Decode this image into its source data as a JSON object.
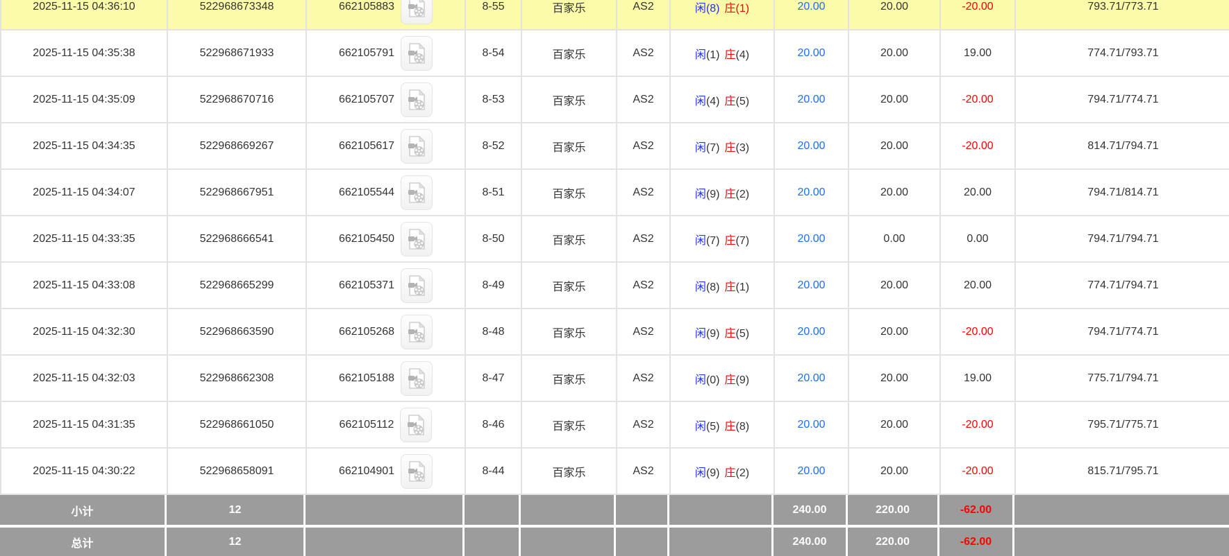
{
  "colors": {
    "highlight_bg": "#fbfba9",
    "summary_bg": "#9c9c9c",
    "amount_blue": "#1a6ff2",
    "player_blue": "#2033f0",
    "banker_red": "#ff0000",
    "negative_red": "#ff0000",
    "text": "#333333",
    "border": "#e2e2e2"
  },
  "table": {
    "result_labels": {
      "player": "闲",
      "banker": "庄"
    },
    "video_icon_name": "video-replay-icon",
    "rows": [
      {
        "time": "2025-11-15 04:36:10",
        "bet_id": "522968673348",
        "round_id": "662105883",
        "round_no": "8-55",
        "game": "百家乐",
        "table": "AS2",
        "player_score": "8",
        "banker_score": "1",
        "valid_bet": "20.00",
        "bet_amount": "20.00",
        "win_loss": "-20.00",
        "balance": "793.71/773.71",
        "highlighted": true
      },
      {
        "time": "2025-11-15 04:35:38",
        "bet_id": "522968671933",
        "round_id": "662105791",
        "round_no": "8-54",
        "game": "百家乐",
        "table": "AS2",
        "player_score": "1",
        "banker_score": "4",
        "valid_bet": "20.00",
        "bet_amount": "20.00",
        "win_loss": "19.00",
        "balance": "774.71/793.71",
        "highlighted": false
      },
      {
        "time": "2025-11-15 04:35:09",
        "bet_id": "522968670716",
        "round_id": "662105707",
        "round_no": "8-53",
        "game": "百家乐",
        "table": "AS2",
        "player_score": "4",
        "banker_score": "5",
        "valid_bet": "20.00",
        "bet_amount": "20.00",
        "win_loss": "-20.00",
        "balance": "794.71/774.71",
        "highlighted": false
      },
      {
        "time": "2025-11-15 04:34:35",
        "bet_id": "522968669267",
        "round_id": "662105617",
        "round_no": "8-52",
        "game": "百家乐",
        "table": "AS2",
        "player_score": "7",
        "banker_score": "3",
        "valid_bet": "20.00",
        "bet_amount": "20.00",
        "win_loss": "-20.00",
        "balance": "814.71/794.71",
        "highlighted": false
      },
      {
        "time": "2025-11-15 04:34:07",
        "bet_id": "522968667951",
        "round_id": "662105544",
        "round_no": "8-51",
        "game": "百家乐",
        "table": "AS2",
        "player_score": "9",
        "banker_score": "2",
        "valid_bet": "20.00",
        "bet_amount": "20.00",
        "win_loss": "20.00",
        "balance": "794.71/814.71",
        "highlighted": false
      },
      {
        "time": "2025-11-15 04:33:35",
        "bet_id": "522968666541",
        "round_id": "662105450",
        "round_no": "8-50",
        "game": "百家乐",
        "table": "AS2",
        "player_score": "7",
        "banker_score": "7",
        "valid_bet": "20.00",
        "bet_amount": "0.00",
        "win_loss": "0.00",
        "balance": "794.71/794.71",
        "highlighted": false
      },
      {
        "time": "2025-11-15 04:33:08",
        "bet_id": "522968665299",
        "round_id": "662105371",
        "round_no": "8-49",
        "game": "百家乐",
        "table": "AS2",
        "player_score": "8",
        "banker_score": "1",
        "valid_bet": "20.00",
        "bet_amount": "20.00",
        "win_loss": "20.00",
        "balance": "774.71/794.71",
        "highlighted": false
      },
      {
        "time": "2025-11-15 04:32:30",
        "bet_id": "522968663590",
        "round_id": "662105268",
        "round_no": "8-48",
        "game": "百家乐",
        "table": "AS2",
        "player_score": "9",
        "banker_score": "5",
        "valid_bet": "20.00",
        "bet_amount": "20.00",
        "win_loss": "-20.00",
        "balance": "794.71/774.71",
        "highlighted": false
      },
      {
        "time": "2025-11-15 04:32:03",
        "bet_id": "522968662308",
        "round_id": "662105188",
        "round_no": "8-47",
        "game": "百家乐",
        "table": "AS2",
        "player_score": "0",
        "banker_score": "9",
        "valid_bet": "20.00",
        "bet_amount": "20.00",
        "win_loss": "19.00",
        "balance": "775.71/794.71",
        "highlighted": false
      },
      {
        "time": "2025-11-15 04:31:35",
        "bet_id": "522968661050",
        "round_id": "662105112",
        "round_no": "8-46",
        "game": "百家乐",
        "table": "AS2",
        "player_score": "5",
        "banker_score": "8",
        "valid_bet": "20.00",
        "bet_amount": "20.00",
        "win_loss": "-20.00",
        "balance": "795.71/775.71",
        "highlighted": false
      },
      {
        "time": "2025-11-15 04:30:22",
        "bet_id": "522968658091",
        "round_id": "662104901",
        "round_no": "8-44",
        "game": "百家乐",
        "table": "AS2",
        "player_score": "9",
        "banker_score": "2",
        "valid_bet": "20.00",
        "bet_amount": "20.00",
        "win_loss": "-20.00",
        "balance": "815.71/795.71",
        "highlighted": false
      }
    ],
    "subtotal": {
      "label": "小计",
      "count": "12",
      "valid_bet": "240.00",
      "bet_amount": "220.00",
      "win_loss": "-62.00"
    },
    "total": {
      "label": "总计",
      "count": "12",
      "valid_bet": "240.00",
      "bet_amount": "220.00",
      "win_loss": "-62.00"
    }
  }
}
